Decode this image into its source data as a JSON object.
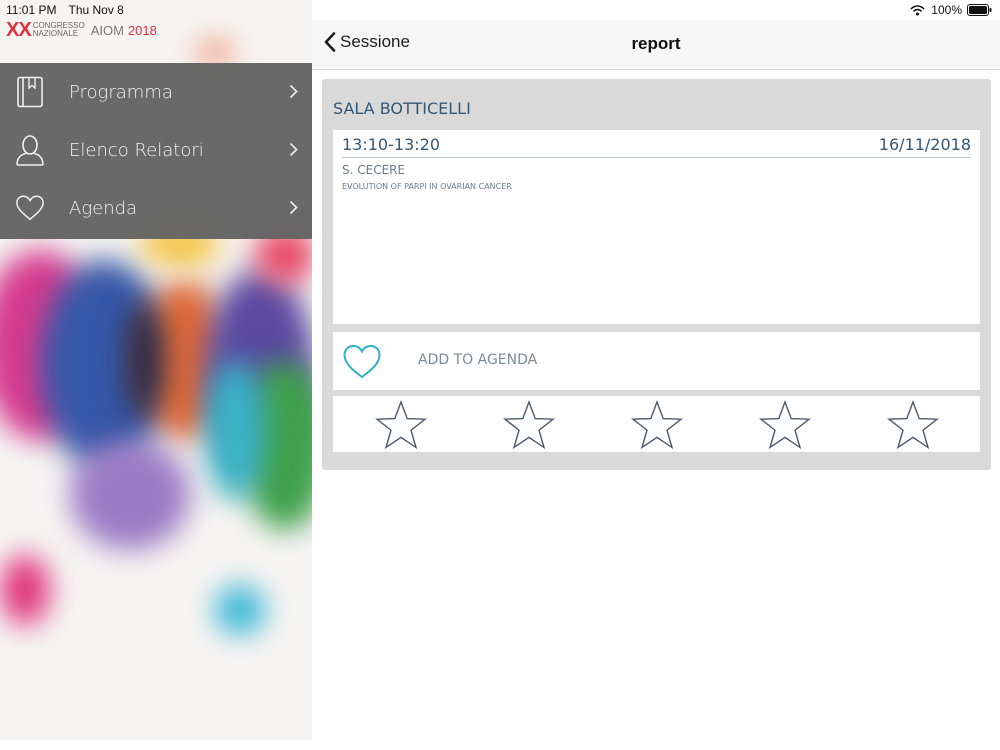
{
  "status": {
    "time": "11:01 PM",
    "date": "Thu Nov 8",
    "battery": "100%"
  },
  "logo": {
    "mark": "XX",
    "line1": "CONGRESSO",
    "line2": "NAZIONALE",
    "name": "AIOM",
    "year": "2018"
  },
  "menu": {
    "items": [
      {
        "label": "Programma",
        "icon": "book-icon"
      },
      {
        "label": "Elenco Relatori",
        "icon": "person-icon"
      },
      {
        "label": "Agenda",
        "icon": "heart-icon"
      }
    ]
  },
  "navbar": {
    "back_label": "Sessione",
    "title": "report"
  },
  "session": {
    "room": "SALA BOTTICELLI",
    "time": "13:10-13:20",
    "date": "16/11/2018",
    "speaker": "S. CECERE",
    "talk": "EVOLUTION OF PARPI IN OVARIAN CANCER"
  },
  "agenda": {
    "label": "ADD TO AGENDA",
    "icon": "heart-outline-icon"
  },
  "rating": {
    "max": 5,
    "value": 0
  },
  "colors": {
    "accent": "#2fb1c3",
    "text_blue": "#345775",
    "menu_bg": "#646464",
    "logo_red": "#e0303f"
  }
}
